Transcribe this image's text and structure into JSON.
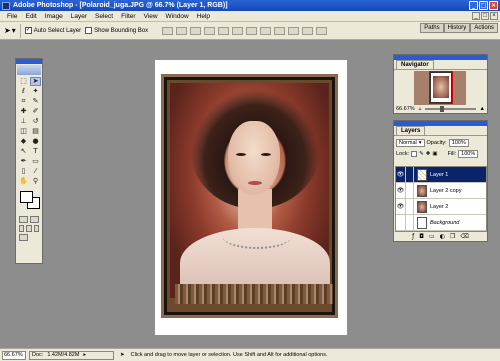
{
  "window": {
    "title": "Adobe Photoshop - [Polaroid_juga.JPG @ 66.7% (Layer 1, RGB)]",
    "btn_min": "_",
    "btn_max": "□",
    "btn_close": "×"
  },
  "menu": {
    "items": [
      "File",
      "Edit",
      "Image",
      "Layer",
      "Select",
      "Filter",
      "View",
      "Window",
      "Help"
    ]
  },
  "options": {
    "auto_select_label": "Auto Select Layer",
    "auto_select_checked": "✓",
    "bounding_box_label": "Show Bounding Box"
  },
  "palette_well": {
    "tabs": [
      "Paths",
      "History",
      "Actions"
    ]
  },
  "navigator": {
    "tabs": [
      "Navigator"
    ],
    "zoom": "66.67%"
  },
  "layers": {
    "tabs": [
      "Layers"
    ],
    "blend_mode": "Normal",
    "opacity_label": "Opacity:",
    "opacity_value": "100%",
    "lock_label": "Lock:",
    "fill_label": "Fill:",
    "fill_value": "100%",
    "rows": [
      {
        "name": "Layer 1",
        "selected": true
      },
      {
        "name": "Layer 2 copy",
        "selected": false
      },
      {
        "name": "Layer 2",
        "selected": false
      },
      {
        "name": "Background",
        "selected": false
      }
    ]
  },
  "status": {
    "zoom": "66.67%",
    "doc_label": "Doc:",
    "doc_value": "1.42M/4.82M",
    "hint": "Click and drag to move layer or selection. Use Shift and Alt for additional options."
  },
  "icons": {
    "eye": "👁",
    "check": "✓"
  }
}
